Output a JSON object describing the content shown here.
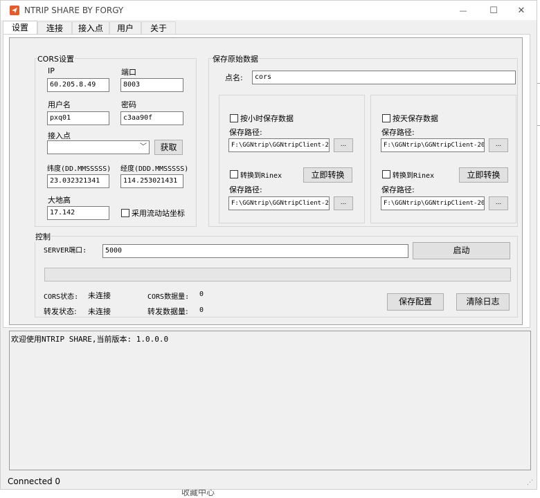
{
  "window": {
    "title": "NTRIP SHARE BY FORGY",
    "minimize_glyph": "—",
    "maximize_glyph": "☐",
    "close_glyph": "✕"
  },
  "tabs": [
    "设置",
    "连接",
    "接入点",
    "用户",
    "关于"
  ],
  "cors": {
    "legend": "CORS设置",
    "ip_label": "IP",
    "ip_value": "60.205.8.49",
    "port_label": "端口",
    "port_value": "8003",
    "user_label": "用户名",
    "user_value": "pxq01",
    "password_label": "密码",
    "password_value": "c3aa90f",
    "mountpoint_label": "接入点",
    "mountpoint_value": "",
    "fetch_button": "获取",
    "lat_label": "纬度(DD.MMSSSSS)",
    "lat_value": "23.032321341",
    "lon_label": "经度(DDD.MMSSSSS)",
    "lon_value": "114.253021431",
    "height_label": "大地高",
    "height_value": "17.142",
    "rover_checkbox": "采用流动站坐标"
  },
  "save_raw": {
    "legend": "保存原始数据",
    "point_label": "点名:",
    "point_value": "cors",
    "hourly": {
      "checkbox": "按小时保存数据",
      "path_label": "保存路径:",
      "path_value": "F:\\GGNtrip\\GGNtripClient-2",
      "browse": "...",
      "rinex_checkbox": "转换到Rinex",
      "convert_button": "立即转换",
      "path2_label": "保存路径:",
      "path2_value": "F:\\GGNtrip\\GGNtripClient-2",
      "browse2": "..."
    },
    "daily": {
      "checkbox": "按天保存数据",
      "path_label": "保存路径:",
      "path_value": "F:\\GGNtrip\\GGNtripClient-20",
      "browse": "...",
      "rinex_checkbox": "转换到Rinex",
      "convert_button": "立即转换",
      "path2_label": "保存路径:",
      "path2_value": "F:\\GGNtrip\\GGNtripClient-20",
      "browse2": "..."
    }
  },
  "control": {
    "legend": "控制",
    "server_port_label": "SERVER端口:",
    "server_port_value": "5000",
    "start_button": "启动",
    "progress": 0,
    "cors_status_label": "CORS状态:",
    "cors_status_value": "未连接",
    "cors_data_label": "CORS数据量:",
    "cors_data_value": "0",
    "forward_status_label": "转发状态:",
    "forward_status_value": "未连接",
    "forward_data_label": "转发数据量:",
    "forward_data_value": "0",
    "save_config_button": "保存配置",
    "clear_log_button": "清除日志"
  },
  "log": {
    "text": "欢迎使用NTRIP SHARE,当前版本: 1.0.0.0"
  },
  "statusbar": {
    "text": "Connected 0"
  },
  "background_snippet": "收藏中心"
}
